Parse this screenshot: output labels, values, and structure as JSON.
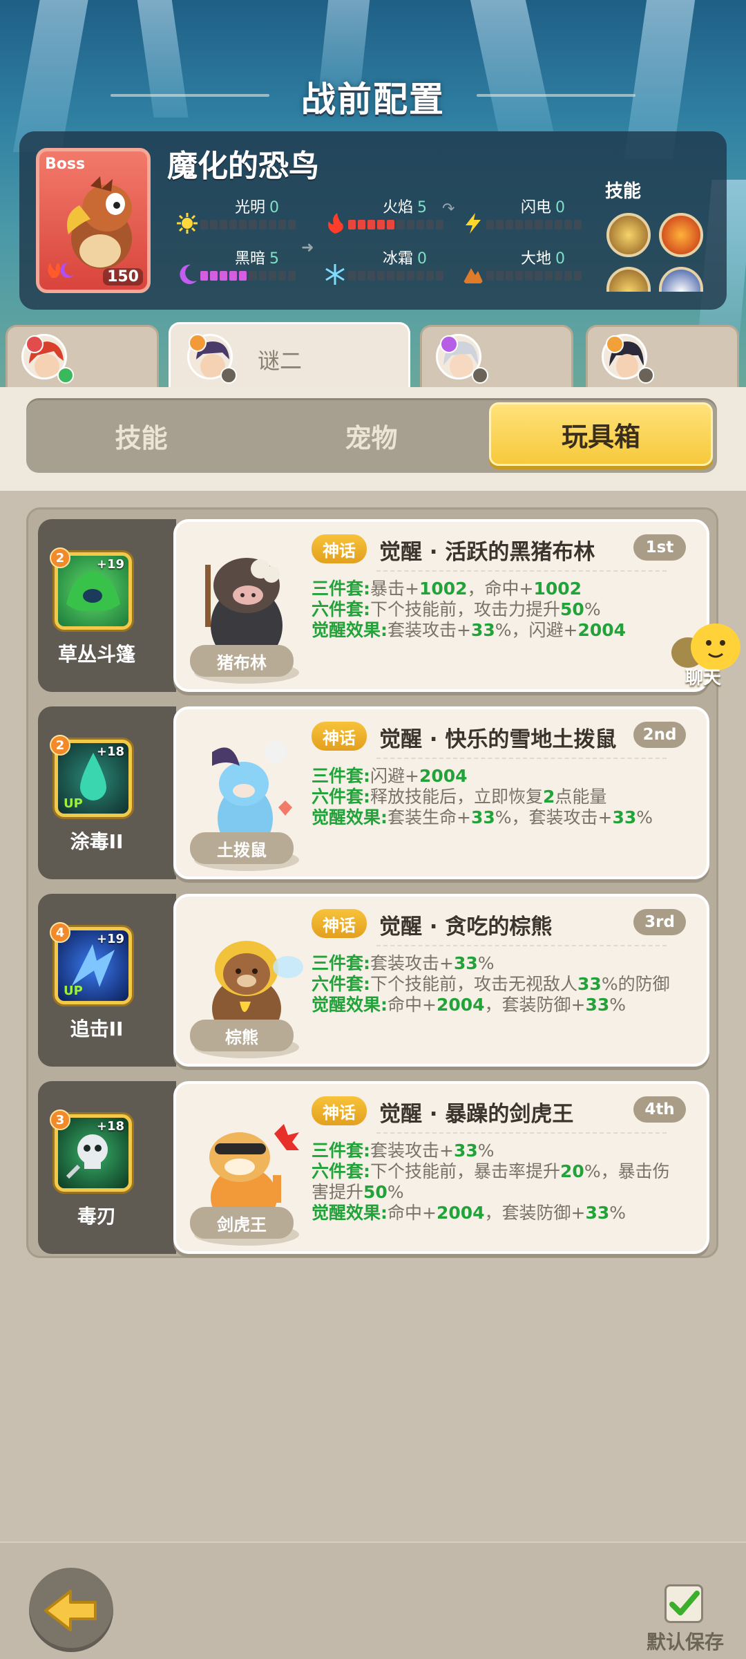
{
  "page_title": "战前配置",
  "boss": {
    "tag": "Boss",
    "name": "魔化的恐鸟",
    "level": "150",
    "elements": [
      {
        "label": "光明",
        "value": "0"
      },
      {
        "label": "火焰",
        "value": "5"
      },
      {
        "label": "闪电",
        "value": "0"
      },
      {
        "label": "黑暗",
        "value": "5"
      },
      {
        "label": "冰霜",
        "value": "0"
      },
      {
        "label": "大地",
        "value": "0"
      }
    ],
    "skills_label": "技能"
  },
  "heroes": [
    {
      "name": ""
    },
    {
      "name": "谜二"
    },
    {
      "name": ""
    },
    {
      "name": ""
    }
  ],
  "tabs": [
    "技能",
    "宠物",
    "玩具箱"
  ],
  "active_tab": "玩具箱",
  "toys": [
    {
      "skill": {
        "name": "草丛斗篷",
        "level": "2",
        "plus": "+19",
        "up": ""
      },
      "pet_name": "猪布林",
      "tag": "神话",
      "title": "觉醒 · 活跃的黑猪布林",
      "rank": "1st",
      "lines": [
        {
          "key": "三件套:",
          "text": "暴击+1002，命中+1002"
        },
        {
          "key": "六件套:",
          "text": "下个技能前，攻击力提升50%"
        },
        {
          "key": "觉醒效果:",
          "text": "套装攻击+33%，闪避+2004"
        }
      ]
    },
    {
      "skill": {
        "name": "涂毒II",
        "level": "2",
        "plus": "+18",
        "up": "UP"
      },
      "pet_name": "土拨鼠",
      "tag": "神话",
      "title": "觉醒 · 快乐的雪地土拨鼠",
      "rank": "2nd",
      "lines": [
        {
          "key": "三件套:",
          "text": "闪避+2004"
        },
        {
          "key": "六件套:",
          "text": "释放技能后，立即恢复2点能量"
        },
        {
          "key": "觉醒效果:",
          "text": "套装生命+33%，套装攻击+33%"
        }
      ]
    },
    {
      "skill": {
        "name": "追击II",
        "level": "4",
        "plus": "+19",
        "up": "UP"
      },
      "pet_name": "棕熊",
      "tag": "神话",
      "title": "觉醒 · 贪吃的棕熊",
      "rank": "3rd",
      "lines": [
        {
          "key": "三件套:",
          "text": "套装攻击+33%"
        },
        {
          "key": "六件套:",
          "text": "下个技能前，攻击无视敌人33%的防御"
        },
        {
          "key": "觉醒效果:",
          "text": "命中+2004，套装防御+33%"
        }
      ]
    },
    {
      "skill": {
        "name": "毒刃",
        "level": "3",
        "plus": "+18",
        "up": ""
      },
      "pet_name": "剑虎王",
      "tag": "神话",
      "title": "觉醒 · 暴躁的剑虎王",
      "rank": "4th",
      "lines": [
        {
          "key": "三件套:",
          "text": "套装攻击+33%"
        },
        {
          "key": "六件套:",
          "text": "下个技能前，暴击率提升20%，暴击伤"
        },
        {
          "key": "",
          "text": "害提升50%"
        },
        {
          "key": "觉醒效果:",
          "text": "命中+2004，套装防御+33%"
        }
      ]
    }
  ],
  "chat_label": "聊天",
  "save_label": "默认保存",
  "icons": [
    "sun-icon",
    "fire-icon",
    "lightning-icon",
    "moon-icon",
    "snowflake-icon",
    "mountain-icon",
    "back-arrow-icon",
    "checkmark-icon",
    "chat-bubble-icon"
  ]
}
